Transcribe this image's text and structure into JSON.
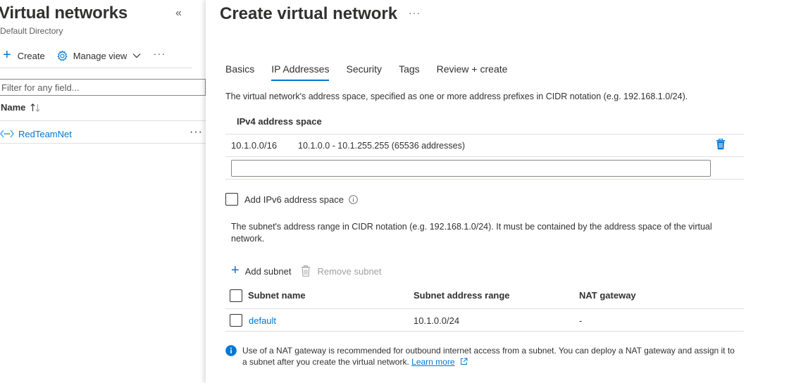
{
  "left_blade": {
    "title": "Virtual networks",
    "subtitle": "Default Directory",
    "toolbar": {
      "create_label": "Create",
      "manage_view_label": "Manage view",
      "more_label": "···"
    },
    "filter_placeholder": "Filter for any field...",
    "column_name": "Name",
    "rows": [
      {
        "name": "RedTeamNet",
        "more": "···"
      }
    ]
  },
  "right_blade": {
    "title": "Create virtual network",
    "more_label": "···",
    "tabs": [
      {
        "label": "Basics",
        "active": false
      },
      {
        "label": "IP Addresses",
        "active": true
      },
      {
        "label": "Security",
        "active": false
      },
      {
        "label": "Tags",
        "active": false
      },
      {
        "label": "Review + create",
        "active": false
      }
    ],
    "address_space_description": "The virtual network's address space, specified as one or more address prefixes in CIDR notation (e.g. 192.168.1.0/24).",
    "ipv4_header": "IPv4 address space",
    "ipv4_entries": [
      {
        "prefix": "10.1.0.0/16",
        "range": "10.1.0.0 - 10.1.255.255 (65536 addresses)"
      }
    ],
    "ipv4_input_value": "",
    "ipv6_checkbox_label": "Add IPv6 address space",
    "subnet_description": "The subnet's address range in CIDR notation (e.g. 192.168.1.0/24). It must be contained by the address space of the virtual network.",
    "subnet_toolbar": {
      "add_label": "Add subnet",
      "remove_label": "Remove subnet"
    },
    "subnet_table": {
      "headers": [
        "Subnet name",
        "Subnet address range",
        "NAT gateway"
      ],
      "rows": [
        {
          "name": "default",
          "range": "10.1.0.0/24",
          "nat": "-"
        }
      ]
    },
    "nat_info": {
      "text": "Use of a NAT gateway is recommended for outbound internet access from a subnet. You can deploy a NAT gateway and assign it to a subnet after you create the virtual network.",
      "link_label": "Learn more"
    }
  },
  "colors": {
    "accent": "#0078d4",
    "text": "#323130",
    "muted": "#605e5c",
    "disabled": "#a19f9d",
    "divider": "#e1dfdd"
  }
}
